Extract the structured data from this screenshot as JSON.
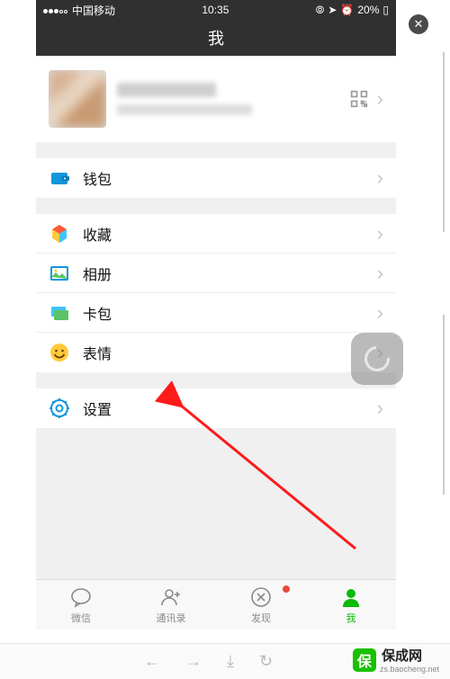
{
  "status": {
    "carrier": "中国移动",
    "time": "10:35",
    "battery": "20%"
  },
  "nav": {
    "title": "我"
  },
  "profile": {
    "name_hidden": true,
    "id_hidden": true
  },
  "groups": [
    {
      "rows": [
        {
          "icon": "wallet",
          "label": "钱包"
        }
      ]
    },
    {
      "rows": [
        {
          "icon": "fav",
          "label": "收藏"
        },
        {
          "icon": "album",
          "label": "相册"
        },
        {
          "icon": "card",
          "label": "卡包"
        },
        {
          "icon": "emoji",
          "label": "表情"
        }
      ]
    },
    {
      "rows": [
        {
          "icon": "settings",
          "label": "设置"
        }
      ]
    }
  ],
  "tabs": [
    {
      "icon": "chat",
      "label": "微信"
    },
    {
      "icon": "contacts",
      "label": "通讯录"
    },
    {
      "icon": "discover",
      "label": "发现",
      "badge": true
    },
    {
      "icon": "me",
      "label": "我",
      "active": true
    }
  ],
  "watermark": {
    "brand": "保成网",
    "url": "zs.baocheng.net"
  }
}
